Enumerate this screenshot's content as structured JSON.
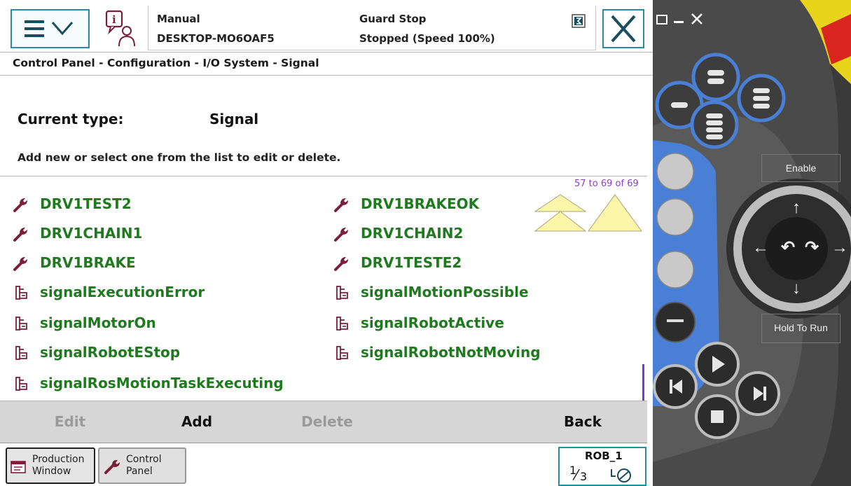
{
  "header": {
    "mode": "Manual",
    "controller": "DESKTOP-MO6OAF5",
    "state": "Guard Stop",
    "speed_status": "Stopped (Speed 100%)"
  },
  "breadcrumb": "Control Panel - Configuration - I/O System - Signal",
  "current_type": {
    "label": "Current type:",
    "value": "Signal"
  },
  "instruction": "Add new or select one from the list to edit or delete.",
  "list": {
    "page_info": "57 to 69 of 69",
    "items": [
      {
        "name": "DRV1TEST2",
        "icon": "wrench-icon"
      },
      {
        "name": "DRV1BRAKEOK",
        "icon": "wrench-icon"
      },
      {
        "name": "DRV1CHAIN1",
        "icon": "wrench-icon"
      },
      {
        "name": "DRV1CHAIN2",
        "icon": "wrench-icon"
      },
      {
        "name": "DRV1BRAKE",
        "icon": "wrench-icon"
      },
      {
        "name": "DRV1TESTE2",
        "icon": "wrench-icon"
      },
      {
        "name": "signalExecutionError",
        "icon": "signal-icon"
      },
      {
        "name": "signalMotionPossible",
        "icon": "signal-icon"
      },
      {
        "name": "signalMotorOn",
        "icon": "signal-icon"
      },
      {
        "name": "signalRobotActive",
        "icon": "signal-icon"
      },
      {
        "name": "signalRobotEStop",
        "icon": "signal-icon"
      },
      {
        "name": "signalRobotNotMoving",
        "icon": "signal-icon"
      },
      {
        "name": "signalRosMotionTaskExecuting",
        "icon": "signal-icon"
      }
    ]
  },
  "commands": {
    "edit": "Edit",
    "add": "Add",
    "delete": "Delete",
    "back": "Back"
  },
  "taskbar": {
    "production_window": "Production\nWindow",
    "production_line1": "Production",
    "production_line2": "Window",
    "control_panel_line1": "Control",
    "control_panel_line2": "Panel",
    "rob_name": "ROB_1",
    "rob_fraction_num": "1",
    "rob_fraction_den": "3"
  },
  "hardware": {
    "enable": "Enable",
    "hold_to_run": "Hold To Run"
  },
  "colors": {
    "accent": "#2a8aa0",
    "signal_text": "#1f7a1f",
    "wrench": "#7a1f3a",
    "page_info": "#8b3fc3",
    "disabled_text": "#9a9a9a",
    "key_blue": "#4a7fd6"
  }
}
